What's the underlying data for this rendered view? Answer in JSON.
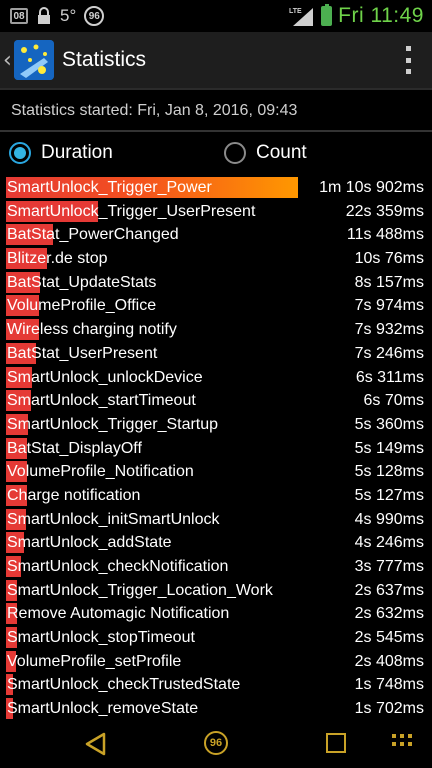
{
  "status_bar": {
    "calendar_day": "08",
    "temperature": "5°",
    "notification_badge": "96",
    "network_type": "LTE",
    "time": "Fri 11:49",
    "accent_color": "#6fd34a"
  },
  "action_bar": {
    "title": "Statistics",
    "up_icon": "chevron-left-icon",
    "app_icon": "app-logo-icon",
    "menu_icon": "overflow-menu-icon"
  },
  "header": {
    "started_text": "Statistics started: Fri, Jan 8, 2016, 09:43"
  },
  "sort_options": {
    "duration_label": "Duration",
    "count_label": "Count",
    "selected": "Duration"
  },
  "stats": {
    "rows": [
      {
        "name": "SmartUnlock_Trigger_Power",
        "value": "1m 10s 902ms",
        "fraction": 1.0
      },
      {
        "name": "SmartUnlock_Trigger_UserPresent",
        "value": "22s 359ms",
        "fraction": 0.315
      },
      {
        "name": "BatStat_PowerChanged",
        "value": "11s 488ms",
        "fraction": 0.162
      },
      {
        "name": "Blitzer.de stop",
        "value": "10s 76ms",
        "fraction": 0.142
      },
      {
        "name": "BatStat_UpdateStats",
        "value": "8s 157ms",
        "fraction": 0.115
      },
      {
        "name": "VolumeProfile_Office",
        "value": "7s 974ms",
        "fraction": 0.112
      },
      {
        "name": "Wireless charging notify",
        "value": "7s 932ms",
        "fraction": 0.112
      },
      {
        "name": "BatStat_UserPresent",
        "value": "7s 246ms",
        "fraction": 0.102
      },
      {
        "name": "SmartUnlock_unlockDevice",
        "value": "6s 311ms",
        "fraction": 0.089
      },
      {
        "name": "SmartUnlock_startTimeout",
        "value": "6s 70ms",
        "fraction": 0.086
      },
      {
        "name": "SmartUnlock_Trigger_Startup",
        "value": "5s 360ms",
        "fraction": 0.076
      },
      {
        "name": "BatStat_DisplayOff",
        "value": "5s 149ms",
        "fraction": 0.073
      },
      {
        "name": "VolumeProfile_Notification",
        "value": "5s 128ms",
        "fraction": 0.072
      },
      {
        "name": "Charge notification",
        "value": "5s 127ms",
        "fraction": 0.072
      },
      {
        "name": "SmartUnlock_initSmartUnlock",
        "value": "4s 990ms",
        "fraction": 0.07
      },
      {
        "name": "SmartUnlock_addState",
        "value": "4s 246ms",
        "fraction": 0.06
      },
      {
        "name": "SmartUnlock_checkNotification",
        "value": "3s 777ms",
        "fraction": 0.053
      },
      {
        "name": "SmartUnlock_Trigger_Location_Work",
        "value": "2s 637ms",
        "fraction": 0.037
      },
      {
        "name": "Remove Automagic Notification",
        "value": "2s 632ms",
        "fraction": 0.037
      },
      {
        "name": "SmartUnlock_stopTimeout",
        "value": "2s 545ms",
        "fraction": 0.036
      },
      {
        "name": "VolumeProfile_setProfile",
        "value": "2s 408ms",
        "fraction": 0.034
      },
      {
        "name": "SmartUnlock_checkTrustedState",
        "value": "1s 748ms",
        "fraction": 0.025
      },
      {
        "name": "SmartUnlock_removeState",
        "value": "1s 702ms",
        "fraction": 0.024
      }
    ]
  },
  "nav_bar": {
    "back_icon": "back-triangle-icon",
    "home_label": "96",
    "recent_icon": "recent-apps-icon",
    "menu_icon": "grid-menu-icon",
    "color": "#c9a227"
  },
  "colors": {
    "bar_red": "#e53935",
    "bar_orange": "#ff9800",
    "radio_selected": "#33b5e5"
  }
}
